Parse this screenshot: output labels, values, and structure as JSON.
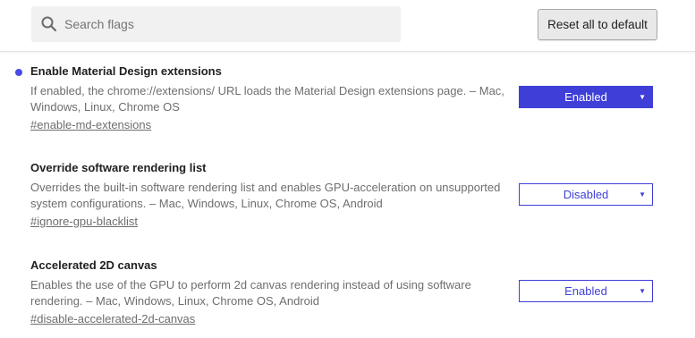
{
  "header": {
    "search_placeholder": "Search flags",
    "reset_label": "Reset all to default"
  },
  "colors": {
    "accent": "#3f3fd8",
    "modified_dot": "#4a4ae6"
  },
  "experiments": [
    {
      "title": "Enable Material Design extensions",
      "description": "If enabled, the chrome://extensions/ URL loads the Material Design extensions page. – Mac, Windows, Linux, Chrome OS",
      "link": "#enable-md-extensions",
      "selected": "Enabled",
      "modified": true
    },
    {
      "title": "Override software rendering list",
      "description": "Overrides the built-in software rendering list and enables GPU-acceleration on unsupported system configurations. – Mac, Windows, Linux, Chrome OS, Android",
      "link": "#ignore-gpu-blacklist",
      "selected": "Disabled",
      "modified": false
    },
    {
      "title": "Accelerated 2D canvas",
      "description": "Enables the use of the GPU to perform 2d canvas rendering instead of using software rendering. – Mac, Windows, Linux, Chrome OS, Android",
      "link": "#disable-accelerated-2d-canvas",
      "selected": "Enabled",
      "modified": false
    }
  ]
}
